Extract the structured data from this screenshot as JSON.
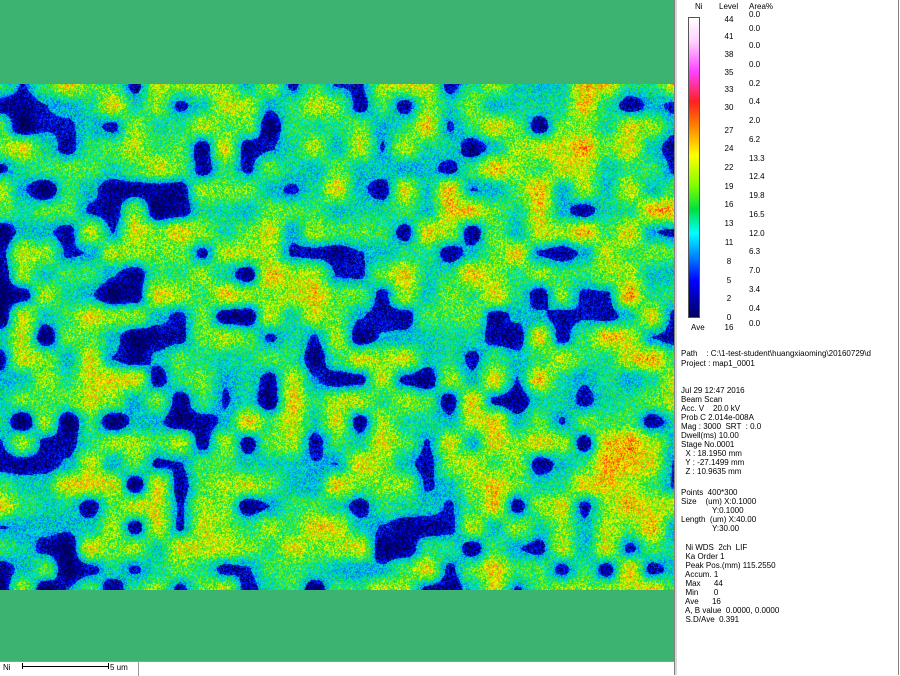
{
  "colors": {
    "map_background": "#3cb371",
    "panel_background": "#ffffff"
  },
  "map": {
    "element": "Ni",
    "scale_label": "5 um"
  },
  "legend": {
    "headers": {
      "element": "Ni",
      "level": "Level",
      "area": "Area%"
    },
    "levels": [
      "44",
      "41",
      "38",
      "35",
      "33",
      "30",
      "27",
      "24",
      "22",
      "19",
      "16",
      "13",
      "11",
      "8",
      "5",
      "2",
      "0"
    ],
    "areas": [
      "0.0",
      "0.0",
      "0.0",
      "0.0",
      "0.2",
      "0.4",
      "2.0",
      "6.2",
      "13.3",
      "12.4",
      "19.8",
      "16.5",
      "12.0",
      "6.3",
      "7.0",
      "3.4",
      "0.4",
      "0.0"
    ],
    "ave_label": "Ave",
    "ave_value": "16"
  },
  "info": {
    "path": "Path    : C:\\1-test-student\\huangxiaoming\\20160729\\d",
    "project": "Project : map1_0001",
    "block1": [
      "Jul 29 12:47 2016",
      "Beam Scan",
      "Acc. V    20.0 kV",
      "Prob C 2.014e-008A",
      "Mag : 3000  SRT  : 0.0",
      "Dwell(ms) 10.00",
      "Stage No.0001",
      "  X : 18.1950 mm",
      "  Y : -27.1499 mm",
      "  Z : 10.9635 mm"
    ],
    "block2": [
      "Points  400*300",
      "Size    (um) X:0.1000",
      "              Y:0.1000",
      "Length  (um) X:40.00",
      "              Y:30.00"
    ],
    "block3": [
      "  Ni WDS  2ch  LIF",
      "  Ka Order 1",
      "  Peak Pos.(mm) 115.2550",
      "  Accum. 1",
      "  Max      44",
      "  Min       0",
      "  Ave      16",
      "  A, B value  0.0000, 0.0000",
      "  S.D/Ave  0.391"
    ]
  }
}
